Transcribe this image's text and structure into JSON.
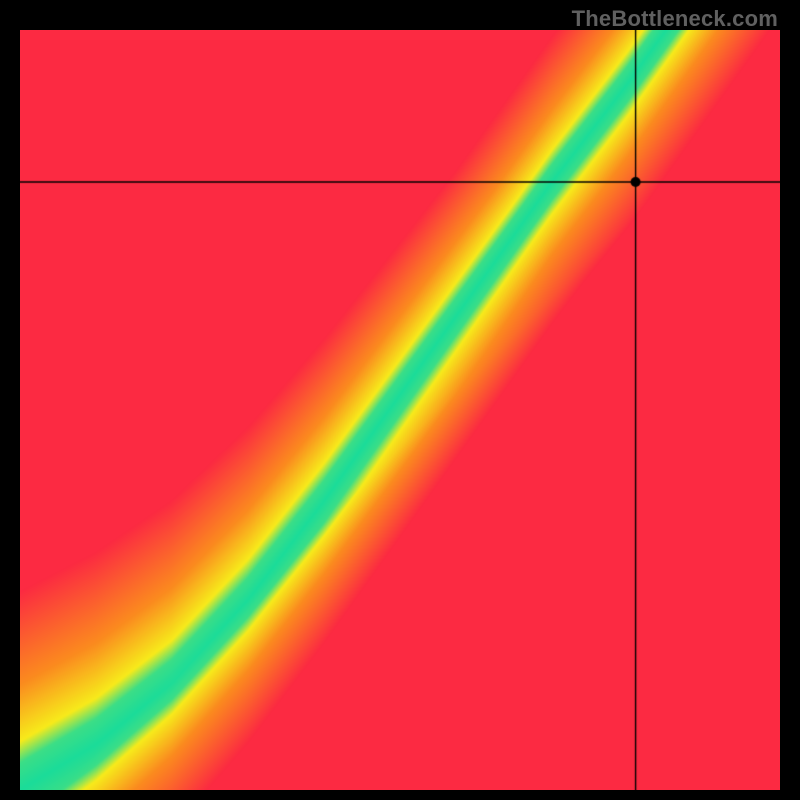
{
  "watermark": "TheBottleneck.com",
  "chart_data": {
    "type": "heatmap",
    "title": "",
    "xlabel": "",
    "ylabel": "",
    "xlim": [
      0,
      100
    ],
    "ylim": [
      0,
      100
    ],
    "crosshair": {
      "x": 81,
      "y": 80
    },
    "optimal_curve_description": "Green optimal band follows a curve roughly y = f(x) rising from bottom-left to top-right, slightly convex; away from it the field grades yellow -> orange -> red.",
    "optimal_curve_points": [
      {
        "x": 0,
        "y": 0
      },
      {
        "x": 10,
        "y": 6
      },
      {
        "x": 20,
        "y": 14
      },
      {
        "x": 30,
        "y": 25
      },
      {
        "x": 40,
        "y": 38
      },
      {
        "x": 50,
        "y": 52
      },
      {
        "x": 60,
        "y": 66
      },
      {
        "x": 70,
        "y": 80
      },
      {
        "x": 80,
        "y": 93
      },
      {
        "x": 85,
        "y": 100
      }
    ],
    "colors": {
      "green": "#1bdc9a",
      "yellow": "#f7eb1b",
      "orange": "#fb8b1f",
      "red": "#fc2a42",
      "crosshair_line": "#000000",
      "crosshair_dot": "#000000"
    },
    "band_width_normalized": 0.06
  }
}
